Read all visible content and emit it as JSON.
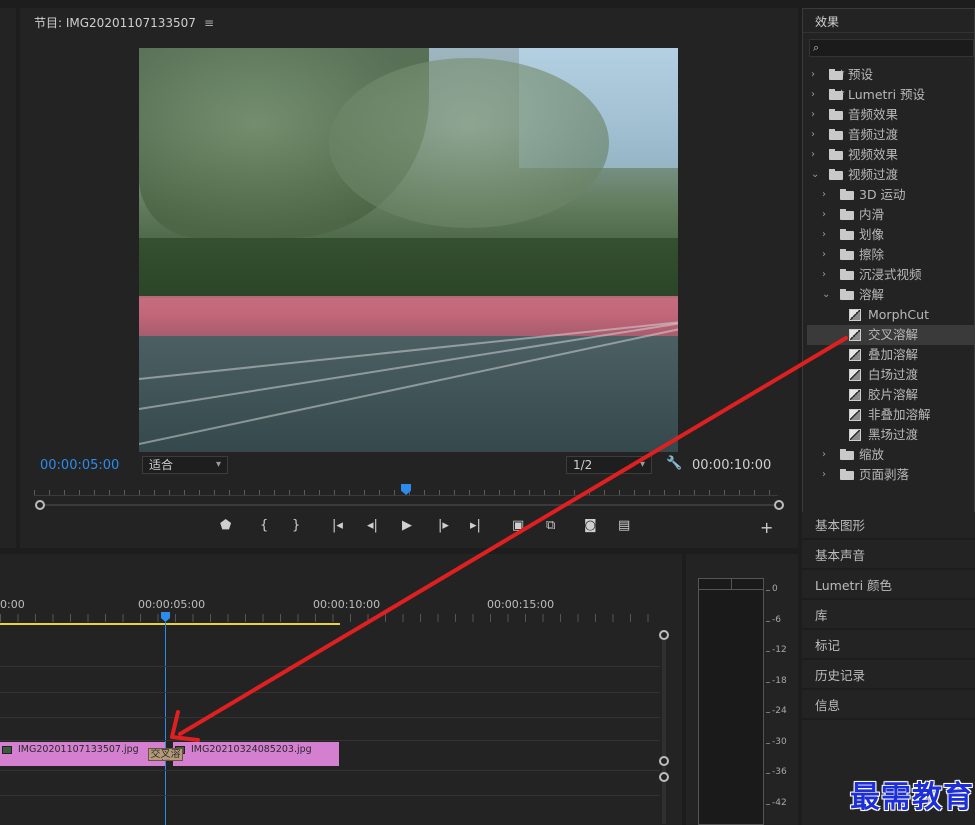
{
  "monitor": {
    "title": "节目: IMG20201107133507",
    "menu_icon": "≡",
    "current_time": "00:00:05:00",
    "fit_label": "适合",
    "resolution_label": "1/2",
    "end_time": "00:00:10:00"
  },
  "effects": {
    "title": "效果",
    "search_placeholder": "",
    "items": [
      {
        "label": "预设",
        "kind": "star-folder",
        "level": 0,
        "expanded": false
      },
      {
        "label": "Lumetri 预设",
        "kind": "star-folder",
        "level": 0,
        "expanded": false
      },
      {
        "label": "音频效果",
        "kind": "folder",
        "level": 0,
        "expanded": false
      },
      {
        "label": "音频过渡",
        "kind": "folder",
        "level": 0,
        "expanded": false
      },
      {
        "label": "视频效果",
        "kind": "folder",
        "level": 0,
        "expanded": false
      },
      {
        "label": "视频过渡",
        "kind": "folder",
        "level": 0,
        "expanded": true
      },
      {
        "label": "3D 运动",
        "kind": "folder",
        "level": 1,
        "expanded": false
      },
      {
        "label": "内滑",
        "kind": "folder",
        "level": 1,
        "expanded": false
      },
      {
        "label": "划像",
        "kind": "folder",
        "level": 1,
        "expanded": false
      },
      {
        "label": "擦除",
        "kind": "folder",
        "level": 1,
        "expanded": false
      },
      {
        "label": "沉浸式视频",
        "kind": "folder",
        "level": 1,
        "expanded": false
      },
      {
        "label": "溶解",
        "kind": "folder",
        "level": 1,
        "expanded": true
      },
      {
        "label": "MorphCut",
        "kind": "effect",
        "level": 2
      },
      {
        "label": "交叉溶解",
        "kind": "effect",
        "level": 2,
        "selected": true
      },
      {
        "label": "叠加溶解",
        "kind": "effect",
        "level": 2
      },
      {
        "label": "白场过渡",
        "kind": "effect",
        "level": 2
      },
      {
        "label": "胶片溶解",
        "kind": "effect",
        "level": 2
      },
      {
        "label": "非叠加溶解",
        "kind": "effect",
        "level": 2
      },
      {
        "label": "黑场过渡",
        "kind": "effect",
        "level": 2
      },
      {
        "label": "缩放",
        "kind": "folder",
        "level": 1,
        "expanded": false
      },
      {
        "label": "页面剥落",
        "kind": "folder",
        "level": 1,
        "expanded": false
      }
    ]
  },
  "panels": [
    "基本图形",
    "基本声音",
    "Lumetri 颜色",
    "库",
    "标记",
    "历史记录",
    "信息"
  ],
  "timeline": {
    "ruler_labels": [
      "0:00",
      "00:00:05:00",
      "00:00:10:00",
      "00:00:15:00"
    ],
    "clip1": "IMG20201107133507.jpg",
    "clip2": "IMG20210324085203.jpg",
    "transition_label": "交叉溶解"
  },
  "meter": {
    "db_labels": [
      "0",
      "-6",
      "-12",
      "-18",
      "-24",
      "-30",
      "-36",
      "-42"
    ]
  },
  "watermark": "最需教育",
  "colors": {
    "accent_blue": "#2d8ceb",
    "clip_pink": "#d47fd0",
    "work_area_yellow": "#e8d33a",
    "arrow_red": "#e02020"
  }
}
